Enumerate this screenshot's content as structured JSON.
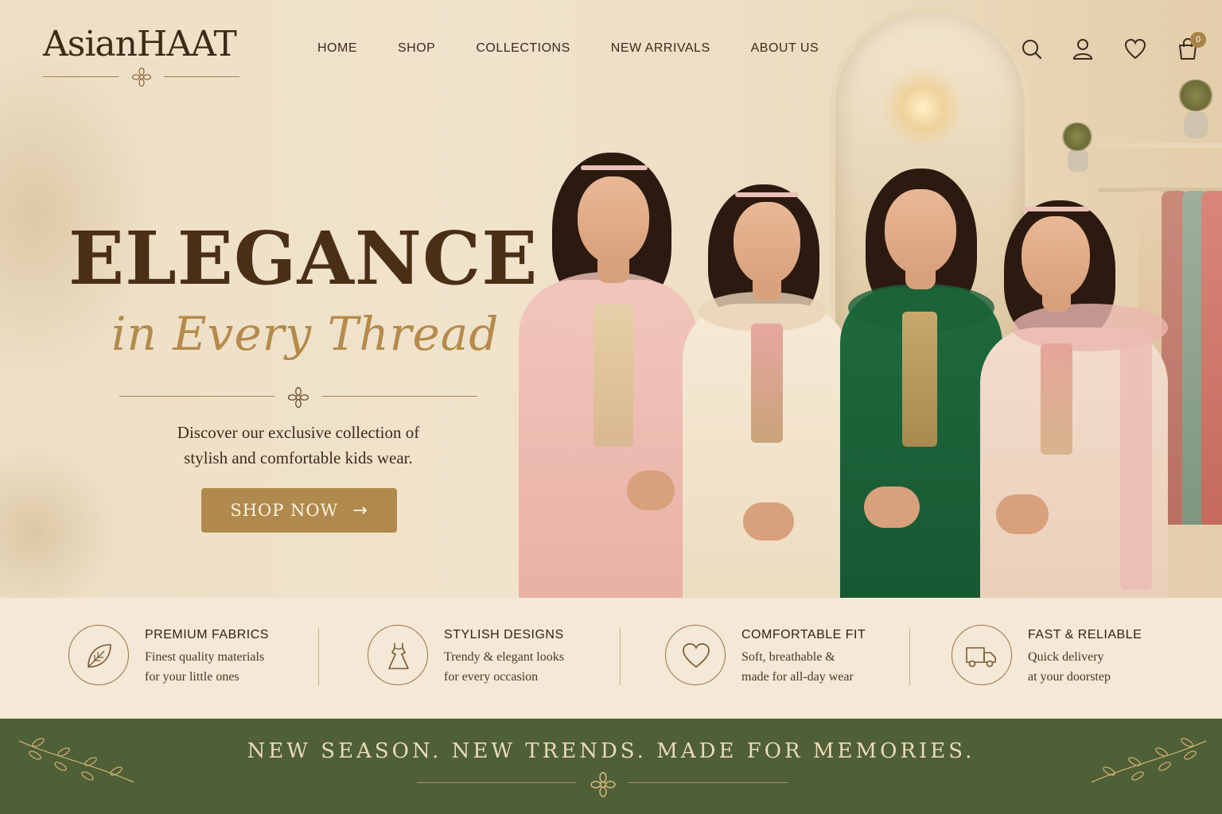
{
  "brand": {
    "name": "AsianHAAT"
  },
  "nav": {
    "items": [
      "HOME",
      "SHOP",
      "COLLECTIONS",
      "NEW ARRIVALS",
      "ABOUT US"
    ]
  },
  "header_icons": [
    "search-icon",
    "user-icon",
    "heart-icon",
    "cart-icon"
  ],
  "cart": {
    "count": "0"
  },
  "hero": {
    "title": "ELEGANCE",
    "script": "in Every Thread",
    "description_line1": "Discover our exclusive collection of",
    "description_line2": "stylish and comfortable kids wear.",
    "cta": "SHOP NOW",
    "cta_arrow": "→"
  },
  "features": [
    {
      "icon": "leaf-icon",
      "title": "PREMIUM FABRICS",
      "line1": "Finest quality materials",
      "line2": "for your little ones"
    },
    {
      "icon": "dress-icon",
      "title": "STYLISH DESIGNS",
      "line1": "Trendy & elegant looks",
      "line2": "for every occasion"
    },
    {
      "icon": "heart-icon",
      "title": "COMFORTABLE FIT",
      "line1": "Soft, breathable &",
      "line2": "made for all-day wear"
    },
    {
      "icon": "truck-icon",
      "title": "FAST & RELIABLE",
      "line1": "Quick delivery",
      "line2": "at your doorstep"
    }
  ],
  "banner": {
    "text": "NEW SEASON. NEW TRENDS. MADE FOR MEMORIES."
  },
  "colors": {
    "accent_gold": "#b08a4c",
    "brand_dark": "#3d2a17",
    "banner_green": "#4f5f36",
    "cream": "#f4e8d6"
  }
}
